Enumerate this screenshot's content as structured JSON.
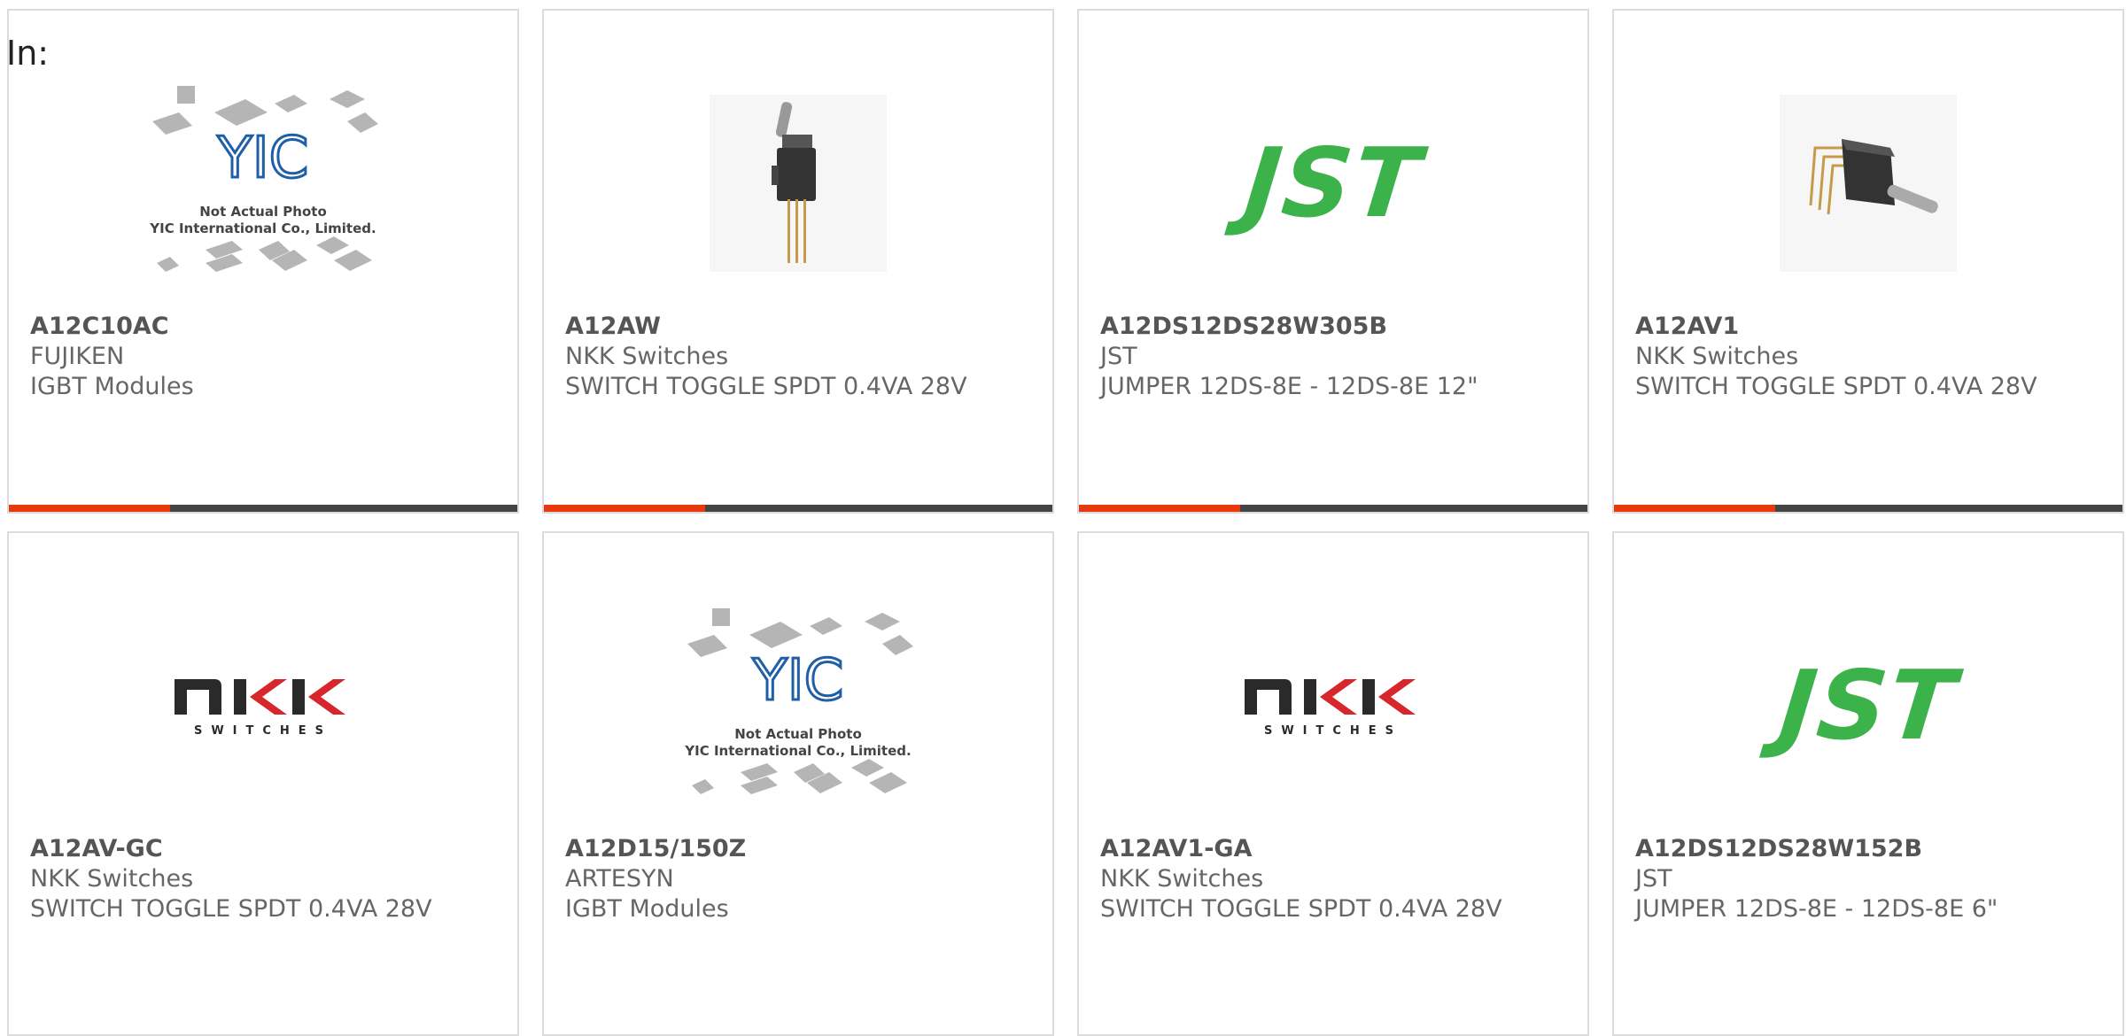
{
  "header": {
    "in_label": "In:"
  },
  "theme": {
    "accent": "#e8380d",
    "bar": "#444444",
    "jst_green": "#3bb34a",
    "nkk_red": "#d8262d"
  },
  "placeholder": {
    "line1": "Not Actual Photo",
    "line2": "YIC International Co., Limited.",
    "logo": "YIC"
  },
  "nkk": {
    "word": "NKK",
    "tagline": "SWITCHES"
  },
  "jst": {
    "word": "JST"
  },
  "cards": [
    {
      "part": "A12C10AC",
      "manufacturer": "FUJIKEN",
      "description": "IGBT Modules",
      "image": "yic-placeholder-image"
    },
    {
      "part": "A12AW",
      "manufacturer": "NKK Switches",
      "description": "SWITCH TOGGLE SPDT 0.4VA 28V",
      "image": "toggle-switch-photo"
    },
    {
      "part": "A12DS12DS28W305B",
      "manufacturer": "JST",
      "description": "JUMPER 12DS-8E - 12DS-8E 12\"",
      "image": "jst-logo"
    },
    {
      "part": "A12AV1",
      "manufacturer": "NKK Switches",
      "description": "SWITCH TOGGLE SPDT 0.4VA 28V",
      "image": "toggle-switch-photo"
    },
    {
      "part": "A12AV-GC",
      "manufacturer": "NKK Switches",
      "description": "SWITCH TOGGLE SPDT 0.4VA 28V",
      "image": "nkk-logo"
    },
    {
      "part": "A12D15/150Z",
      "manufacturer": "ARTESYN",
      "description": "IGBT Modules",
      "image": "yic-placeholder-image"
    },
    {
      "part": "A12AV1-GA",
      "manufacturer": "NKK Switches",
      "description": "SWITCH TOGGLE SPDT 0.4VA 28V",
      "image": "nkk-logo"
    },
    {
      "part": "A12DS12DS28W152B",
      "manufacturer": "JST",
      "description": "JUMPER 12DS-8E - 12DS-8E 6\"",
      "image": "jst-logo"
    }
  ]
}
